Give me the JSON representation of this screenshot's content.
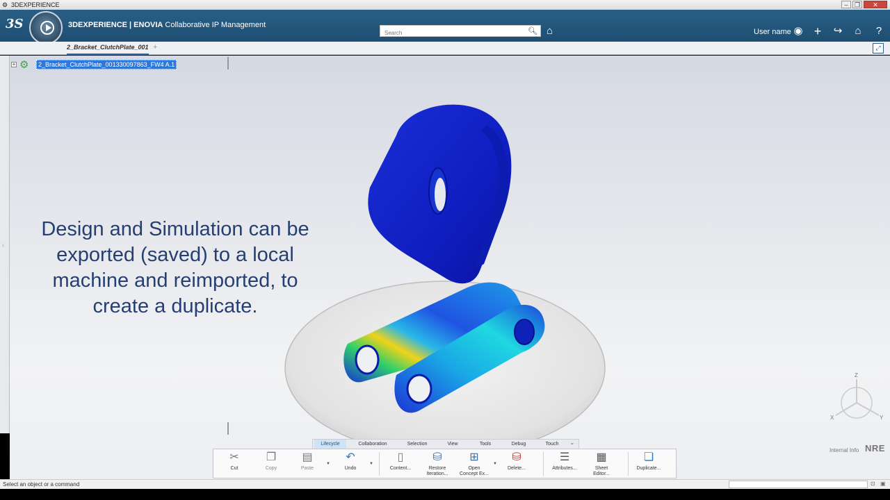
{
  "window": {
    "title": "3DEXPERIENCE"
  },
  "header": {
    "brand": "3DEXPERIENCE | ",
    "product": "ENOVIA",
    "app_name": " Collaborative IP Management",
    "search_placeholder": "Search",
    "user_name": "User name"
  },
  "tabs": [
    {
      "label": "2_Bracket_ClutchPlate_001"
    }
  ],
  "tree": {
    "root_label": "2_Bracket_ClutchPlate_001330097863_FW4 A.1"
  },
  "caption": {
    "line1": "Design and Simulation can be",
    "line2": "exported (saved) to a local",
    "line3": "machine and reimported, to",
    "line4": "create a duplicate."
  },
  "triad_labels": {
    "z": "Z",
    "x": "X",
    "y": "Y"
  },
  "watermark": {
    "internal": "Internal Info",
    "nre": "NRE"
  },
  "action_bar": {
    "tabs": [
      "Lifecycle",
      "Collaboration",
      "Selection",
      "View",
      "Tools",
      "Debug",
      "Touch"
    ],
    "active_tab": "Lifecycle",
    "commands": {
      "cut": "Cut",
      "copy": "Copy",
      "paste": "Paste",
      "undo": "Undo",
      "content": "Content...",
      "restore_1": "Restore",
      "restore_2": "Iteration...",
      "open_1": "Open",
      "open_2": "Concept Ex...",
      "delete": "Delete...",
      "attributes": "Attributes...",
      "sheet_1": "Sheet",
      "sheet_2": "Editor...",
      "duplicate": "Duplicate..."
    }
  },
  "status": {
    "message": "Select an object or a command"
  }
}
